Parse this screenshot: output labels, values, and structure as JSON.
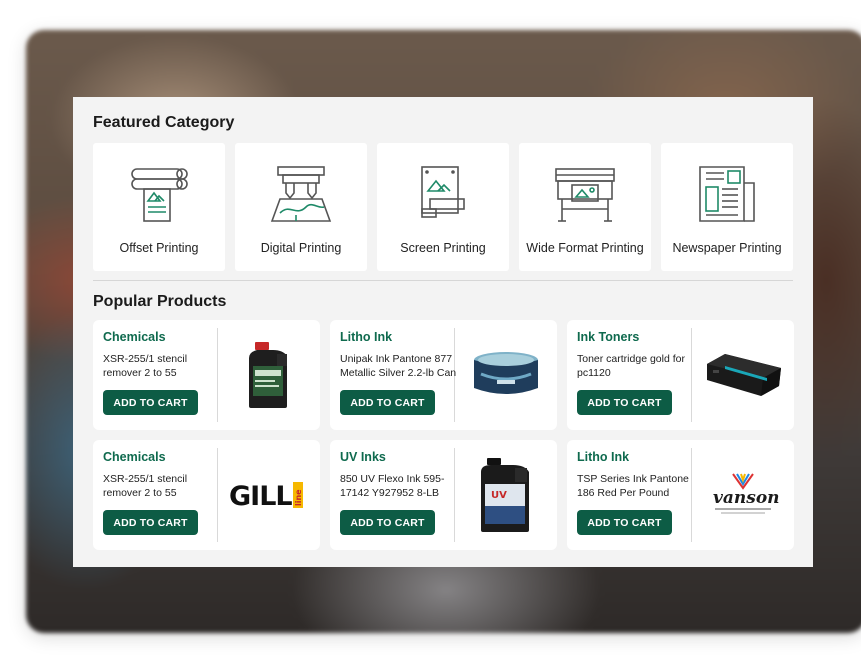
{
  "featured": {
    "title": "Featured Category",
    "categories": [
      {
        "label": "Offset Printing",
        "icon": "offset-press-icon"
      },
      {
        "label": "Digital Printing",
        "icon": "digital-printer-icon"
      },
      {
        "label": "Screen Printing",
        "icon": "screen-print-icon"
      },
      {
        "label": "Wide Format Printing",
        "icon": "plotter-icon"
      },
      {
        "label": "Newspaper Printing",
        "icon": "newspaper-icon"
      }
    ]
  },
  "popular": {
    "title": "Popular Products",
    "cart_label": "ADD TO CART",
    "products": [
      {
        "category": "Chemicals",
        "name": "XSR-255/1 stencil remover 2 to 55",
        "image": "chemical-jug-image"
      },
      {
        "category": "Litho Ink",
        "name": "Unipak Ink Pantone 877 Metallic Silver 2.2-lb Can",
        "image": "ink-can-image"
      },
      {
        "category": "Ink Toners",
        "name": "Toner cartridge gold for pc1120",
        "image": "toner-cartridge-image"
      },
      {
        "category": "Chemicals",
        "name": "XSR-255/1 stencil remover 2 to 55",
        "image": "gill-logo",
        "logo_text": "GILL",
        "logo_sub": "line"
      },
      {
        "category": "UV Inks",
        "name": "850 UV Flexo Ink 595-17142 Y927952 8-LB",
        "image": "uv-ink-jug-image",
        "jug_text": "UV"
      },
      {
        "category": "Litho Ink",
        "name": "TSP Series Ink Pantone 186 Red Per Pound",
        "image": "vanson-logo",
        "logo_text": "vanson"
      }
    ]
  },
  "colors": {
    "accent": "#0d5c45",
    "category_text": "#0f6a4e",
    "icon_stroke": "#555555",
    "icon_green": "#1f8a68"
  }
}
